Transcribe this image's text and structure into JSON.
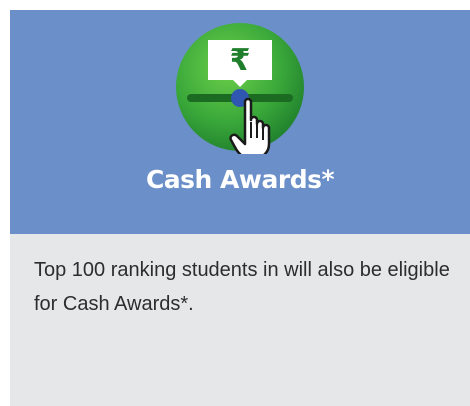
{
  "card": {
    "title": "Cash Awards*",
    "description": "Top 100 ranking students in will also be eligible for Cash Awards*.",
    "icon": "cash-award-slider-hand-icon",
    "currency_symbol": "₹"
  },
  "colors": {
    "header_background": "#6b8fc8",
    "body_background": "#e6e7e8",
    "icon_green": "#3fae3c",
    "slider_knob": "#2f56b0",
    "title_text": "#ffffff"
  }
}
